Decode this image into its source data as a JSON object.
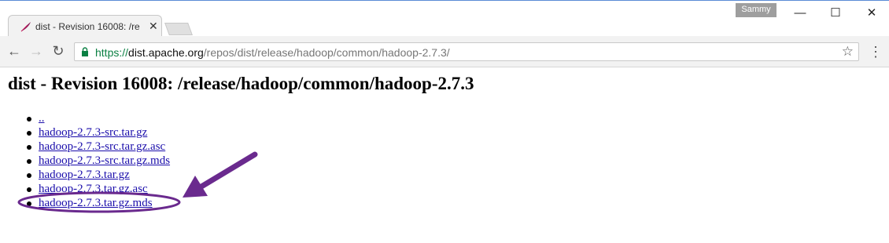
{
  "browser": {
    "tab": {
      "title": "dist - Revision 16008: /re",
      "close_glyph": "✕"
    },
    "profile_name": "Sammy",
    "window_controls": {
      "minimize": "—",
      "maximize": "☐",
      "close": "✕"
    },
    "toolbar": {
      "back": "←",
      "forward": "→",
      "reload": "↻",
      "star": "☆",
      "menu": "⋮"
    },
    "address": {
      "scheme": "https://",
      "host": "dist.apache.org",
      "path": "/repos/dist/release/hadoop/common/hadoop-2.7.3/"
    },
    "accent_colors": {
      "secure": "#0b8043",
      "link": "#1a0dab",
      "annotation": "#6a2a8e"
    }
  },
  "page": {
    "heading": "dist - Revision 16008: /release/hadoop/common/hadoop-2.7.3",
    "links": [
      "..",
      "hadoop-2.7.3-src.tar.gz",
      "hadoop-2.7.3-src.tar.gz.asc",
      "hadoop-2.7.3-src.tar.gz.mds",
      "hadoop-2.7.3.tar.gz",
      "hadoop-2.7.3.tar.gz.asc",
      "hadoop-2.7.3.tar.gz.mds"
    ]
  }
}
